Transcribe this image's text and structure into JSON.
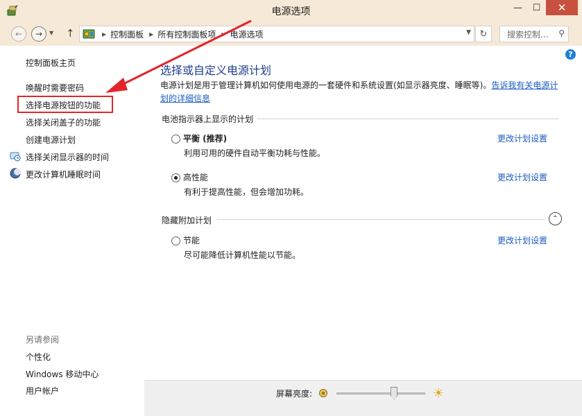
{
  "window": {
    "title": "电源选项",
    "min_glyph": "—",
    "max_glyph": "☐",
    "close_glyph": "✕"
  },
  "nav": {
    "back_glyph": "←",
    "forward_glyph": "→",
    "recent_glyph": "▼",
    "up_glyph": "↑",
    "breadcrumbs": [
      "控制面板",
      "所有控制面板项",
      "电源选项"
    ],
    "crumb_sep": "▶",
    "addr_dropdown_glyph": "▼",
    "refresh_glyph": "↻",
    "search_placeholder": "搜索控制...",
    "search_glyph": "⚲"
  },
  "help_glyph": "?",
  "sidebar": {
    "home": "控制面板主页",
    "links": [
      "唤醒时需要密码",
      "选择电源按钮的功能",
      "选择关闭盖子的功能",
      "创建电源计划",
      "选择关闭显示器的时间",
      "更改计算机睡眠时间"
    ],
    "see_also_title": "另请参阅",
    "see_also": [
      "个性化",
      "Windows 移动中心",
      "用户帐户"
    ]
  },
  "main": {
    "title": "选择或自定义电源计划",
    "description": "电源计划是用于管理计算机如何使用电源的一套硬件和系统设置(如显示器亮度、睡眠等)。",
    "description_link": "告诉我有关电源计划的详细信息",
    "battery_section": "电池指示器上显示的计划",
    "hidden_section": "隐藏附加计划",
    "collapse_glyph": "⌃",
    "plans": [
      {
        "name": "平衡 (推荐)",
        "desc": "利用可用的硬件自动平衡功耗与性能。",
        "link": "更改计划设置",
        "selected": false
      },
      {
        "name": "高性能",
        "desc": "有利于提高性能，但会增加功耗。",
        "link": "更改计划设置",
        "selected": true
      },
      {
        "name": "节能",
        "desc": "尽可能降低计算机性能以节能。",
        "link": "更改计划设置",
        "selected": false
      }
    ]
  },
  "brightness": {
    "label": "屏幕亮度:",
    "level_fraction": 0.65,
    "bright_glyph": "☀"
  },
  "colors": {
    "annotation": "#e3242b",
    "link": "#1a5bc4",
    "title": "#1e3d8c"
  }
}
